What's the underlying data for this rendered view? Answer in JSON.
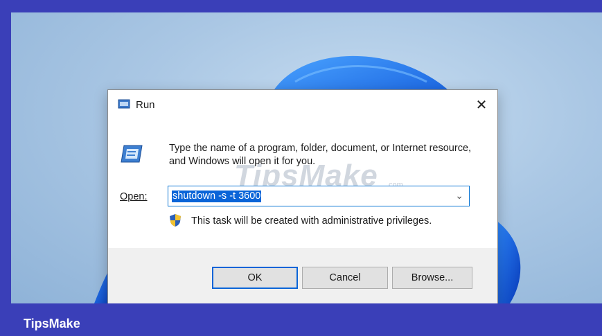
{
  "dialog": {
    "title": "Run",
    "close_glyph": "✕",
    "description": "Type the name of a program, folder, document, or Internet resource, and Windows will open it for you.",
    "open_label": "Open:",
    "open_value": "shutdown -s -t 3600",
    "admin_notice": "This task will be created with administrative privileges.",
    "buttons": {
      "ok": "OK",
      "cancel": "Cancel",
      "browse": "Browse..."
    }
  },
  "watermark": {
    "text": "TipsMake",
    "sub": ".com"
  },
  "footer": {
    "brand": "TipsMake"
  },
  "colors": {
    "frame": "#3a3fb8",
    "accent": "#0a64d8",
    "button_bar": "#f0f0f0"
  },
  "icons": [
    "run-app-icon",
    "run-large-icon",
    "uac-shield-icon",
    "chevron-down-icon",
    "close-icon"
  ]
}
